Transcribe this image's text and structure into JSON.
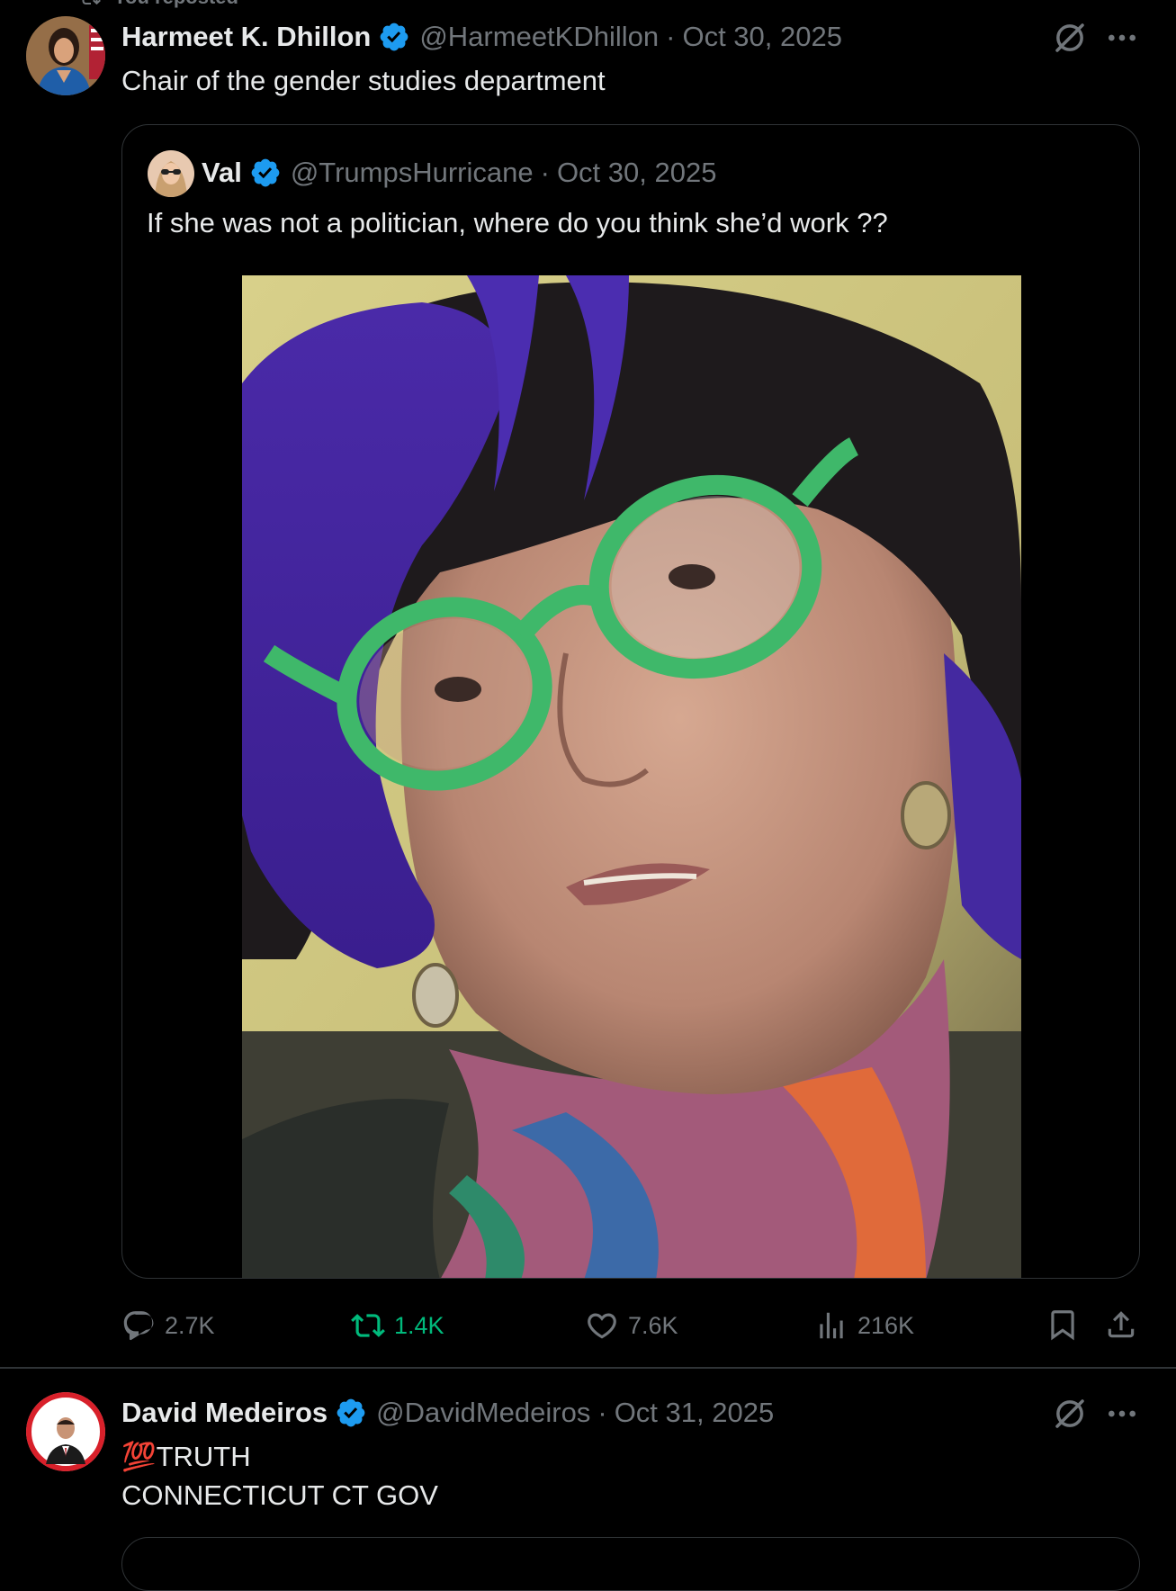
{
  "repost_banner": {
    "text": "You reposted"
  },
  "tweets": [
    {
      "display_name": "Harmeet K. Dhillon",
      "handle": "@HarmeetKDhillon",
      "separator": "·",
      "date": "Oct 30, 2025",
      "text": "Chair of the gender studies department",
      "quote": {
        "display_name": "Val",
        "handle": "@TrumpsHurricane",
        "separator": "·",
        "date": "Oct 30, 2025",
        "text": "If she was not a politician, where do you think she’d work ??"
      },
      "actions": {
        "replies": "2.7K",
        "reposts": "1.4K",
        "likes": "7.6K",
        "views": "216K"
      }
    },
    {
      "display_name": "David Medeiros",
      "handle": "@DavidMedeiros",
      "separator": "·",
      "date": "Oct 31, 2025",
      "text_line1": "💯TRUTH",
      "text_line2": "CONNECTICUT CT GOV"
    }
  ],
  "icons": {
    "repost": "repost-icon",
    "verified": "verified-badge-icon",
    "grok": "grok-icon",
    "more": "more-icon",
    "reply": "reply-icon",
    "like": "heart-icon",
    "views": "views-icon",
    "bookmark": "bookmark-icon",
    "share": "share-icon"
  },
  "colors": {
    "background": "#000000",
    "text": "#e7e9ea",
    "muted": "#71767b",
    "verified": "#1d9bf0",
    "repost_active": "#00ba7c",
    "border": "#2f3336"
  }
}
